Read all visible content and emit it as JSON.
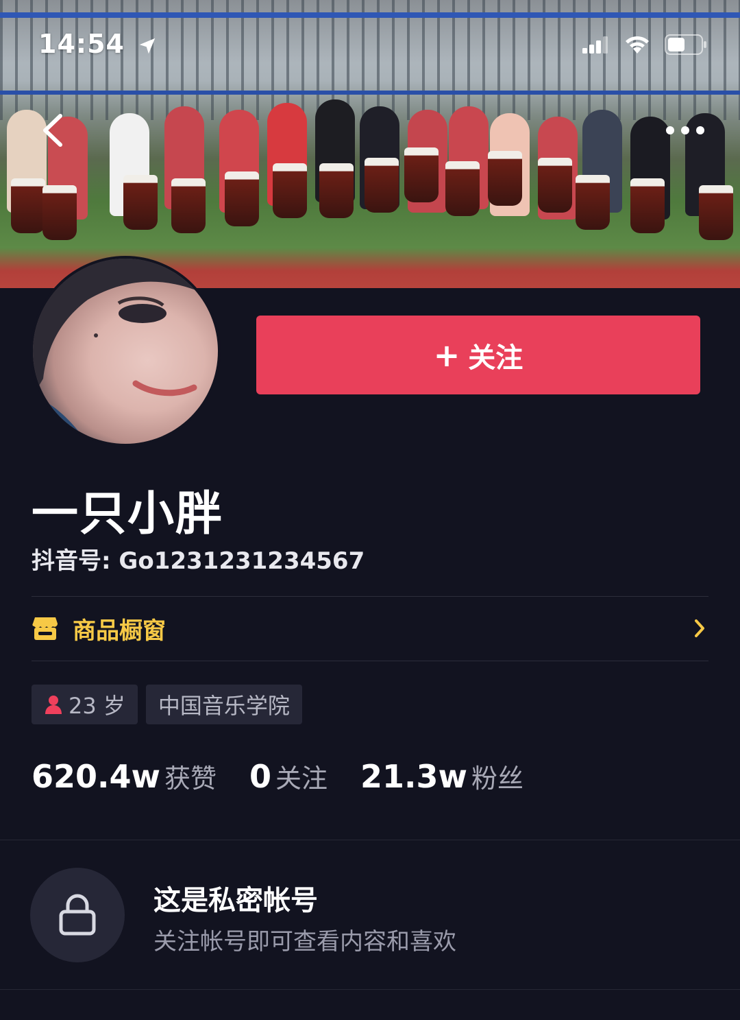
{
  "status_bar": {
    "time": "14:54"
  },
  "profile": {
    "follow_button_label": "关注",
    "follow_icon": "+",
    "username": "一只小胖",
    "account_id": "抖音号: Go1231231234567"
  },
  "shop": {
    "label": "商品橱窗",
    "icon": "storefront-icon",
    "accent_color": "#f7c946"
  },
  "tags": {
    "age": "23 岁",
    "school": "中国音乐学院"
  },
  "stats": {
    "likes_count": "620.4w",
    "likes_label": "获赞",
    "following_count": "0",
    "following_label": "关注",
    "followers_count": "21.3w",
    "followers_label": "粉丝"
  },
  "private_notice": {
    "title": "这是私密帐号",
    "subtitle": "关注帐号即可查看内容和喜欢",
    "icon": "lock-icon"
  },
  "colors": {
    "background": "#121320",
    "follow_button": "#e9405a",
    "tag_background": "#262737"
  }
}
